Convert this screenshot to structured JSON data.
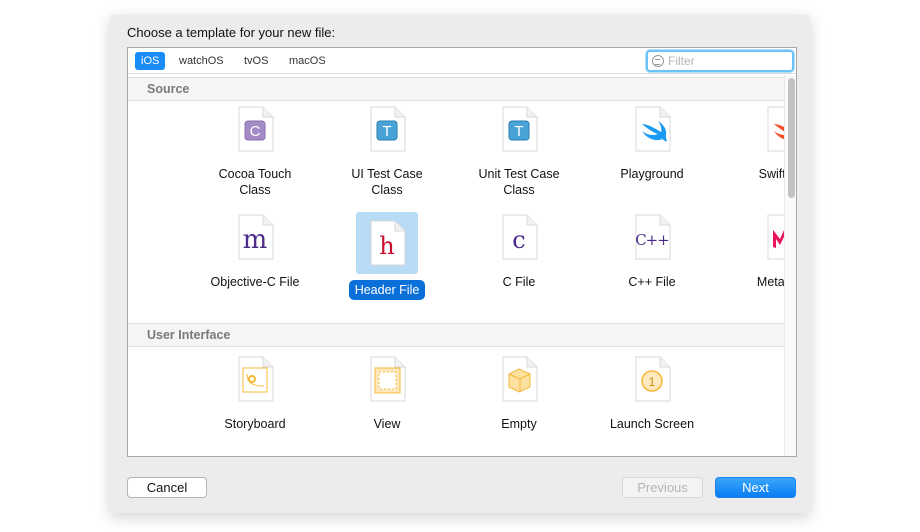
{
  "dialog": {
    "title": "Choose a template for your new file:"
  },
  "tabs": [
    {
      "label": "iOS",
      "active": true
    },
    {
      "label": "watchOS"
    },
    {
      "label": "tvOS"
    },
    {
      "label": "macOS"
    }
  ],
  "filter": {
    "placeholder": "Filter",
    "value": ""
  },
  "sections": [
    {
      "title": "Source",
      "items": [
        {
          "label": "Cocoa Touch Class",
          "icon": "cocoa-touch-class-icon",
          "glyph": "C",
          "color": "#a48bc6"
        },
        {
          "label": "UI Test Case Class",
          "icon": "ui-test-icon",
          "glyph": "T",
          "color": "#4aa3d6"
        },
        {
          "label": "Unit Test Case Class",
          "icon": "unit-test-icon",
          "glyph": "T",
          "color": "#4aa3d6"
        },
        {
          "label": "Playground",
          "icon": "playground-swift-icon",
          "color": "#1b9cf2"
        },
        {
          "label": "Swift File",
          "icon": "swift-icon",
          "color": "#f5502a"
        },
        {
          "label": "Objective-C File",
          "icon": "objc-m-icon",
          "glyph": "m",
          "color": "#4b2a8a"
        },
        {
          "label": "Header File",
          "icon": "header-h-icon",
          "glyph": "h",
          "color": "#c8102e",
          "selected": true
        },
        {
          "label": "C File",
          "icon": "c-file-icon",
          "glyph": "c",
          "color": "#4b2a8a"
        },
        {
          "label": "C++ File",
          "icon": "cpp-file-icon",
          "glyph": "C++",
          "color": "#4b2a8a"
        },
        {
          "label": "Metal File",
          "icon": "metal-icon",
          "color": "#e8155e"
        }
      ]
    },
    {
      "title": "User Interface",
      "items": [
        {
          "label": "Storyboard",
          "icon": "storyboard-icon",
          "color": "#f5b83a"
        },
        {
          "label": "View",
          "icon": "view-icon",
          "color": "#f5b83a"
        },
        {
          "label": "Empty",
          "icon": "empty-cube-icon",
          "color": "#f5b83a"
        },
        {
          "label": "Launch Screen",
          "icon": "launch-screen-icon",
          "glyph": "1",
          "color": "#f5b83a"
        }
      ]
    }
  ],
  "buttons": {
    "cancel": "Cancel",
    "previous": "Previous",
    "next": "Next"
  }
}
